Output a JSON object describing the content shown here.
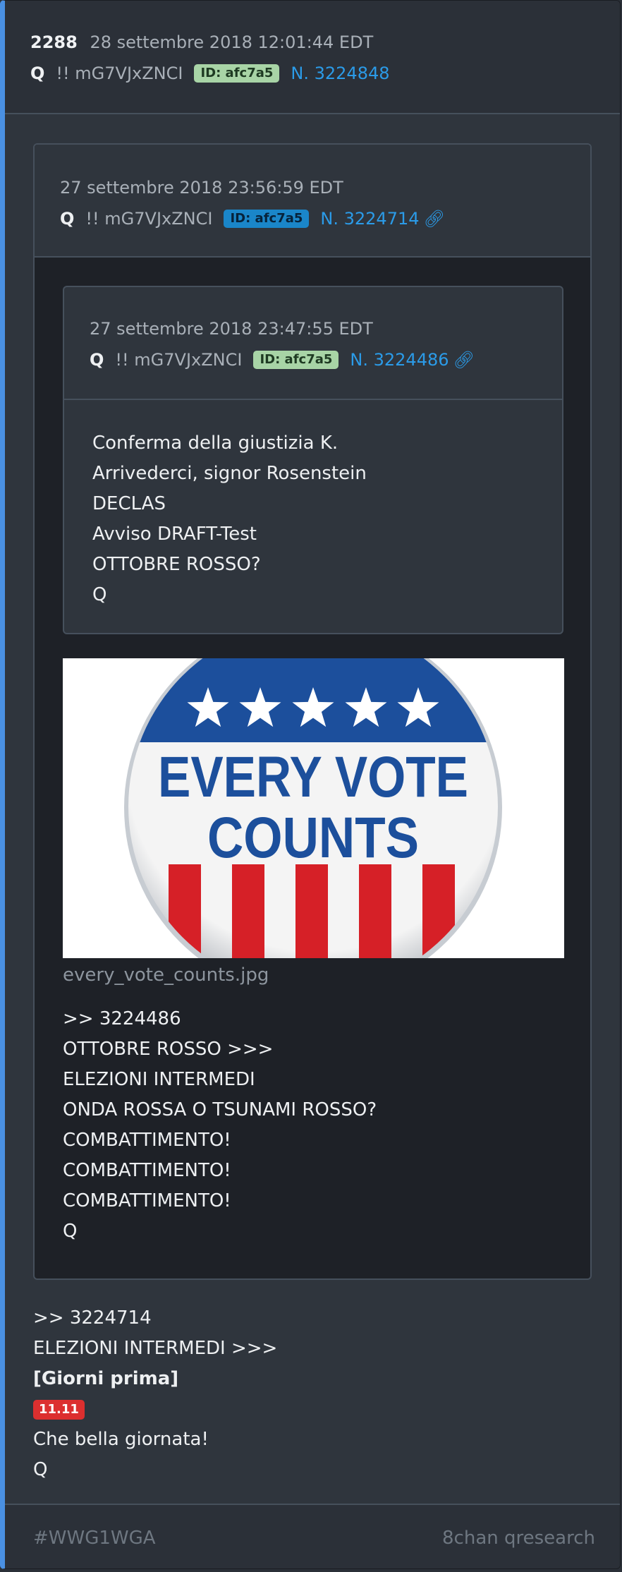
{
  "post": {
    "number": "2288",
    "date": "28 settembre 2018 12:01:44 EDT",
    "author": "Q",
    "tripcode": "!! mG7VJxZNCI",
    "id_badge": "ID: afc7a5",
    "post_no": "N. 3224848",
    "body": [
      ">> 3224714",
      "ELEZIONI INTERMEDI >>>",
      "[Giorni prima]",
      "11.11",
      "Che bella giornata!",
      "Q"
    ]
  },
  "quote1": {
    "date": "27 settembre 2018 23:56:59 EDT",
    "author": "Q",
    "tripcode": "!! mG7VJxZNCI",
    "id_badge": "ID: afc7a5",
    "post_no": "N. 3224714",
    "link_icon": "link-icon",
    "image": {
      "filename": "every_vote_counts.jpg",
      "line1": "EVERY VOTE",
      "line2": "COUNTS",
      "blue": "#1c4f9c",
      "red": "#d62027"
    },
    "body": [
      ">> 3224486",
      "OTTOBRE ROSSO >>>",
      "ELEZIONI INTERMEDI",
      "ONDA ROSSA O TSUNAMI ROSSO?",
      "COMBATTIMENTO!",
      "COMBATTIMENTO!",
      "COMBATTIMENTO!",
      "Q"
    ]
  },
  "quote2": {
    "date": "27 settembre 2018 23:47:55 EDT",
    "author": "Q",
    "tripcode": "!! mG7VJxZNCI",
    "id_badge": "ID: afc7a5",
    "post_no": "N. 3224486",
    "link_icon": "link-icon",
    "body": [
      "Conferma della giustizia K.",
      "Arrivederci, signor Rosenstein",
      "DECLAS",
      "Avviso DRAFT-Test",
      "OTTOBRE ROSSO?",
      "Q"
    ]
  },
  "footer": {
    "tag": "#WWG1WGA",
    "board": "8chan qresearch"
  },
  "colors": {
    "accent": "#4a90e2",
    "link": "#2b9be8",
    "id_green": "#a8d4a6",
    "id_blue": "#1a86c9",
    "badge_red": "#dc2f2f"
  }
}
